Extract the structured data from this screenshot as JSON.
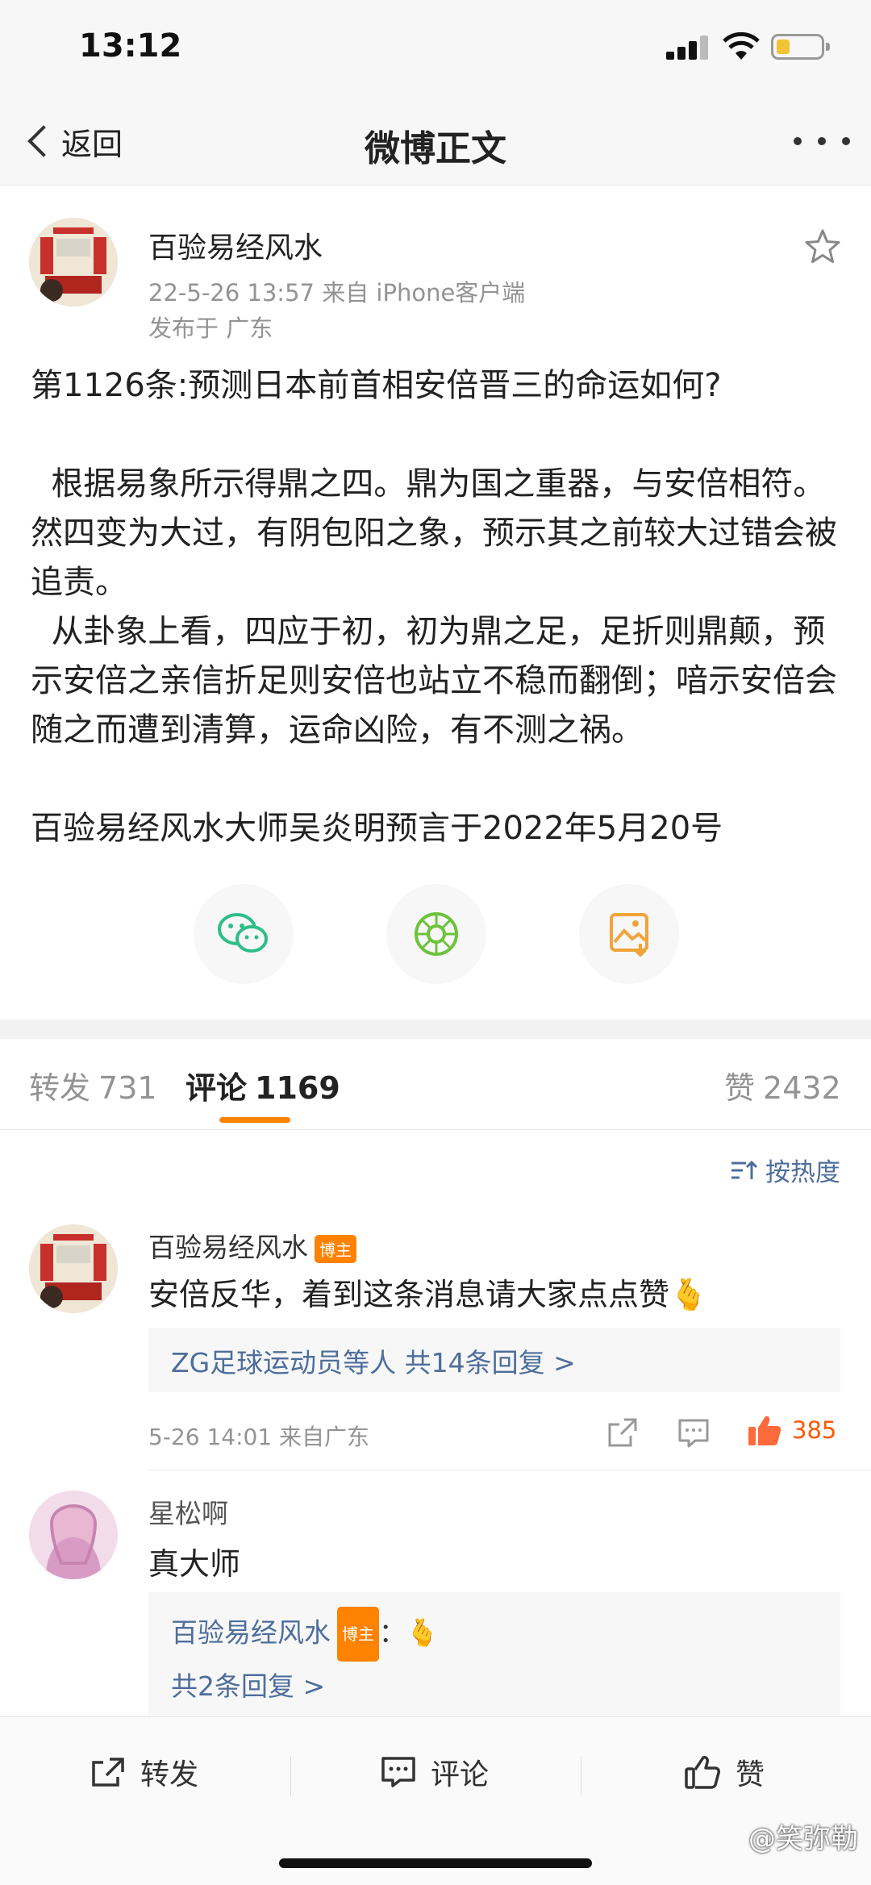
{
  "status_bar": {
    "time": "13:12"
  },
  "nav": {
    "back_label": "返回",
    "title": "微博正文"
  },
  "post": {
    "username": "百验易经风水",
    "meta": "22-5-26 13:57  来自 iPhone客户端",
    "location": "发布于 广东",
    "paragraphs": [
      "第1126条:预测日本前首相安倍晋三的命运如何?",
      "",
      "  根据易象所示得鼎之四。鼎为国之重器，与安倍相符。然四变为大过，有阴包阳之象，预示其之前较大过错会被追责。",
      "  从卦象上看，四应于初，初为鼎之足，足折则鼎颠，预示安倍之亲信折足则安倍也站立不稳而翻倒；喑示安倍会随之而遭到清算，运命凶险，有不测之祸。",
      "",
      "百验易经风水大师吴炎明预言于2022年5月20号"
    ]
  },
  "tabs": {
    "repost_label": "转发",
    "repost_count": "731",
    "comment_label": "评论",
    "comment_count": "1169",
    "like_label": "赞",
    "like_count": "2432"
  },
  "sort_label": "按热度",
  "comments": [
    {
      "username": "百验易经风水",
      "badge": "博主",
      "text": "安倍反华，着到这条消息请大家点点赞🫰",
      "reply_summary": "ZG足球运动员等人  共14条回复 >",
      "time": "5-26 14:01 来自广东",
      "likes": "385"
    },
    {
      "username": "星松啊",
      "text": "真大师",
      "reply_user": "百验易经风水",
      "reply_badge": "博主",
      "reply_text": "：🫰",
      "reply_count": "共2条回复 >"
    }
  ],
  "bottom_bar": {
    "repost": "转发",
    "comment": "评论",
    "like": "赞"
  },
  "watermark": "@笑弥勒",
  "colors": {
    "accent": "#ff8200",
    "link": "#4e6e9b",
    "like_active": "#ff5800"
  }
}
